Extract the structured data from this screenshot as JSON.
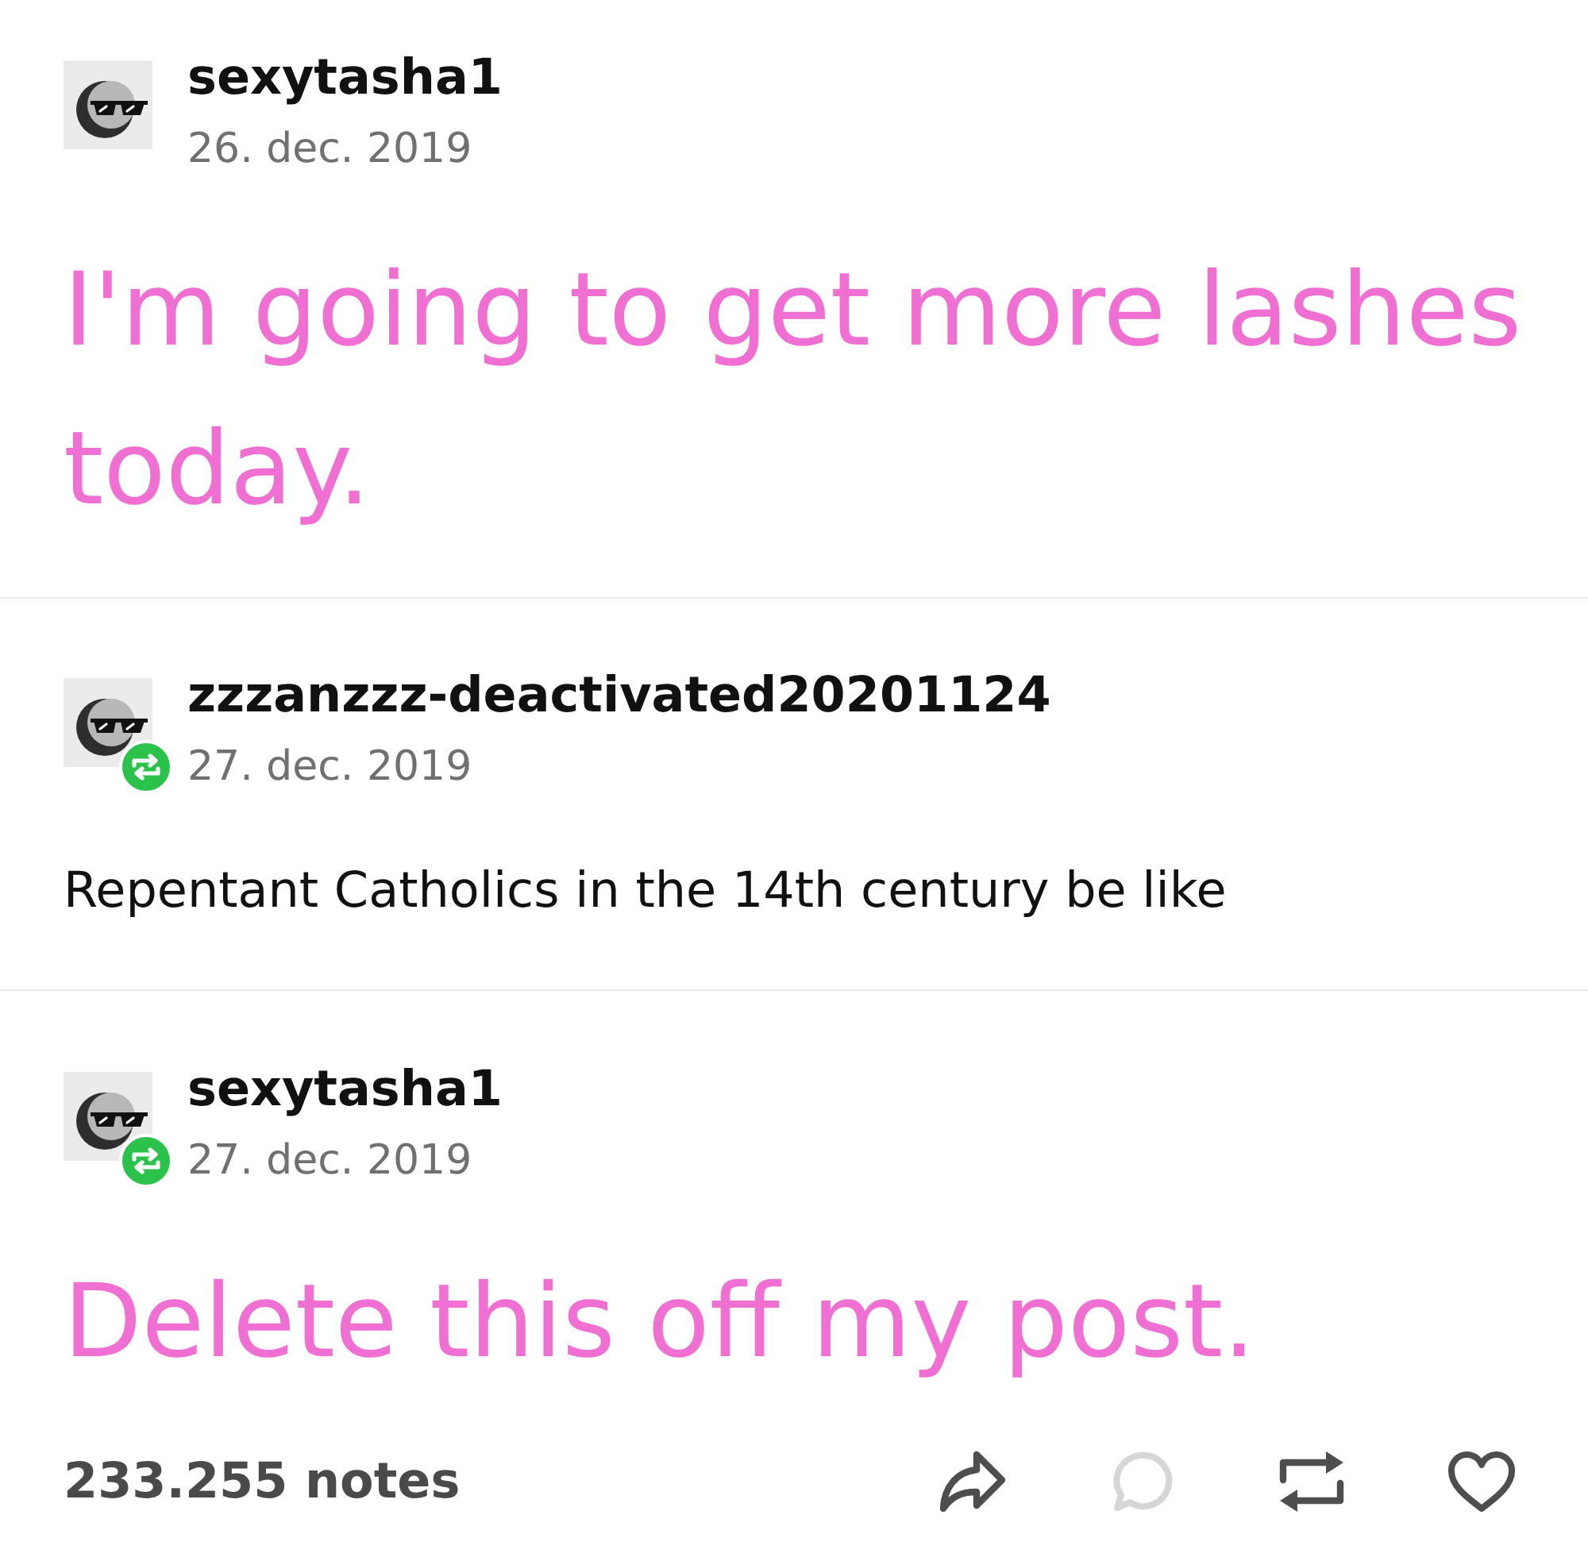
{
  "posts": [
    {
      "username": "sexytasha1",
      "date": "26. dec. 2019",
      "reblogged": false,
      "kind": "big",
      "body": "I'm going to get more lashes today."
    },
    {
      "username": "zzzanzzz-deactivated20201124",
      "date": "27. dec. 2019",
      "reblogged": true,
      "kind": "normal",
      "body": "Repentant Catholics in the 14th century be like"
    },
    {
      "username": "sexytasha1",
      "date": "27. dec. 2019",
      "reblogged": true,
      "kind": "big",
      "body": "Delete this off my post."
    }
  ],
  "footer": {
    "notes": "233.255 notes",
    "actions": [
      {
        "kind": "share",
        "disabled": false
      },
      {
        "kind": "reply",
        "disabled": true
      },
      {
        "kind": "reblog",
        "disabled": false
      },
      {
        "kind": "like",
        "disabled": false
      }
    ]
  }
}
